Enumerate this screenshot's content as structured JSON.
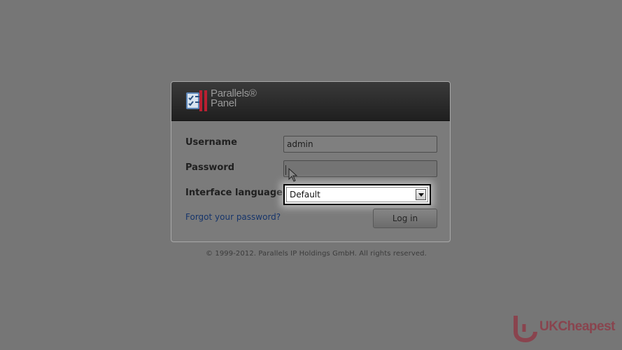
{
  "brand": {
    "line1": "Parallels®",
    "line2": "Panel",
    "logo_icon": "parallels-panel-logo-icon"
  },
  "form": {
    "username_label": "Username",
    "username_value": "admin",
    "password_label": "Password",
    "password_value": "",
    "language_label": "Interface language",
    "language_value": "Default",
    "forgot_password_link": "Forgot your password?",
    "login_button": "Log in"
  },
  "footer": {
    "copyright": "© 1999-2012. Parallels IP Holdings GmbH. All rights reserved."
  },
  "watermark": {
    "text": "UKCheapest",
    "icon": "uk-cheapest-logo-icon"
  },
  "colors": {
    "overlay_gray": "#767676",
    "header_black": "#1f1f1f",
    "link_blue": "#16356b",
    "highlight_white": "#ffffff",
    "watermark_red": "#991c2d"
  }
}
